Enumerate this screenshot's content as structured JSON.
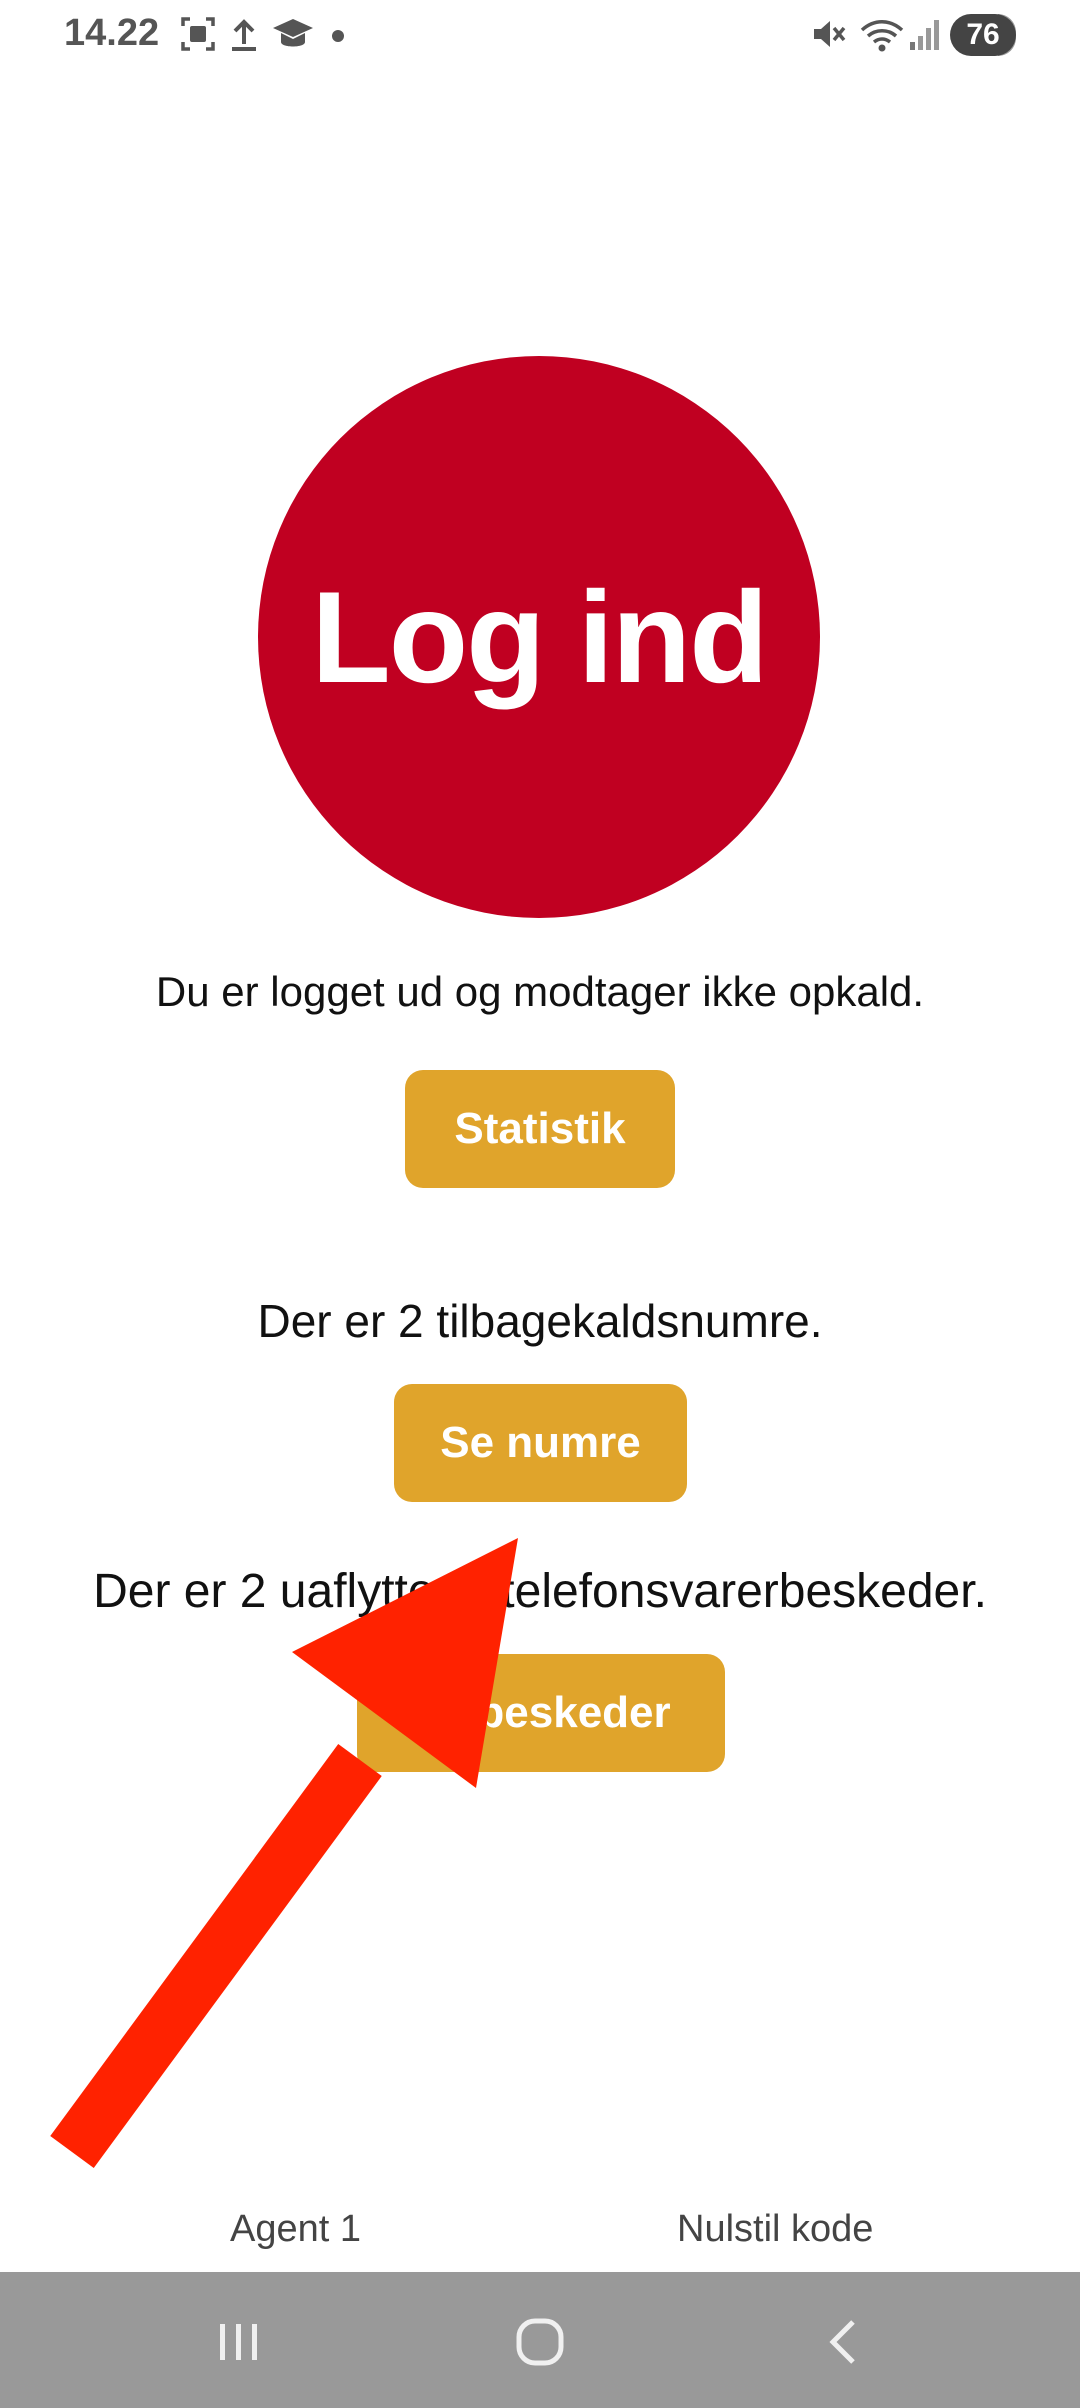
{
  "status_bar": {
    "time": "14.22",
    "battery": "76",
    "icons": [
      "screenshot-icon",
      "upload-icon",
      "graduation-cap-icon",
      "notification-dot-icon",
      "mute-icon",
      "wifi-icon",
      "signal-icon"
    ]
  },
  "main": {
    "login_button_label": "Log ind",
    "logged_out_message": "Du er logget ud og modtager ikke opkald.",
    "statistics_button_label": "Statistik",
    "callbacks_message": "Der er 2 tilbagekaldsnumre.",
    "show_numbers_button_label": "Se numre",
    "voicemail_message": "Der er 2 uaflyttede telefonsvarerbeskeder.",
    "messages_button_label": "Se beskeder"
  },
  "footer": {
    "agent_label": "Agent 1",
    "reset_code_label": "Nulstil kode"
  },
  "navigation_bar": {
    "recents": "recents-icon",
    "home": "home-icon",
    "back": "back-icon"
  },
  "colors": {
    "login_red": "#c00021",
    "button_gold": "#e0a42b",
    "arrow_red": "#ff2200",
    "nav_gray": "#999999"
  }
}
